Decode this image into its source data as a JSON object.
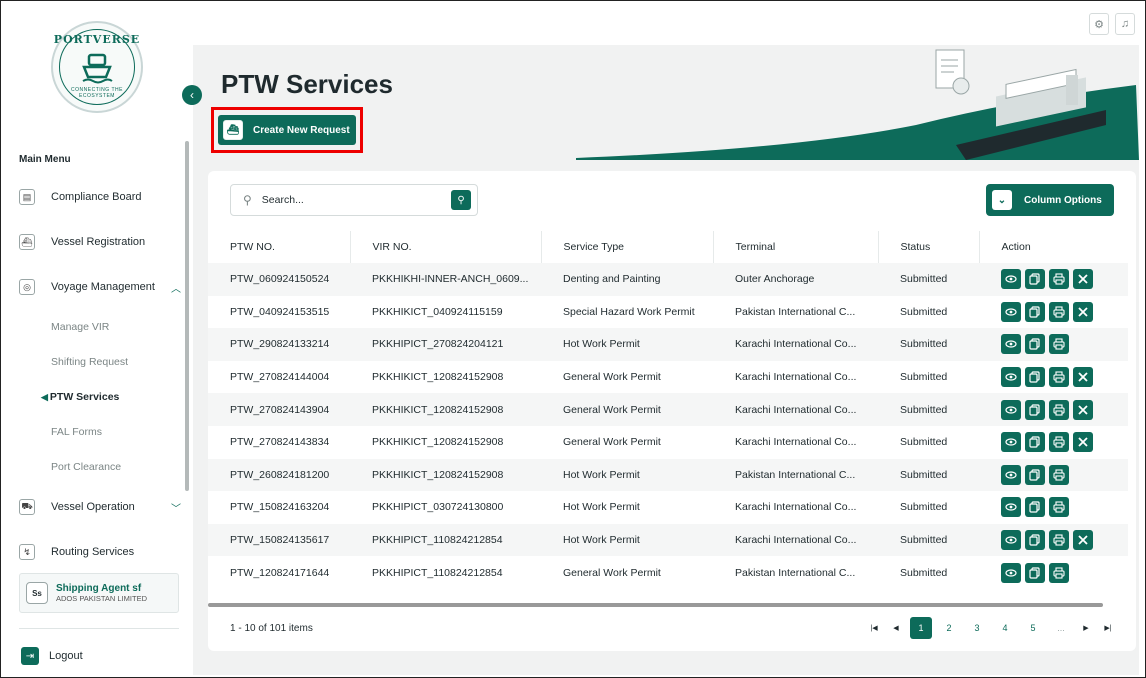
{
  "brand": {
    "name": "PORTVERSE",
    "tagline": "CONNECTING THE ECOSYSTEM"
  },
  "sidebar": {
    "menu_title": "Main Menu",
    "items": [
      {
        "label": "Compliance Board",
        "icon": "clipboard-icon"
      },
      {
        "label": "Vessel Registration",
        "icon": "ship-icon"
      },
      {
        "label": "Voyage Management",
        "icon": "shield-icon",
        "expanded": true
      },
      {
        "label": "Vessel Operation",
        "icon": "crane-icon",
        "expanded": false
      },
      {
        "label": "Routing Services",
        "icon": "route-icon"
      }
    ],
    "sub_items": [
      {
        "label": "Manage VIR"
      },
      {
        "label": "Shifting Request"
      },
      {
        "label": "PTW Services",
        "active": true
      },
      {
        "label": "FAL Forms"
      },
      {
        "label": "Port Clearance"
      }
    ],
    "agent": {
      "initials": "Ss",
      "name": "Shipping Agent sf",
      "org": "ADOS PAKISTAN LIMITED"
    },
    "logout": "Logout"
  },
  "header": {
    "title": "PTW Services",
    "create_label": "Create New Request"
  },
  "toolbar": {
    "search_placeholder": "Search...",
    "column_options": "Column Options"
  },
  "table": {
    "columns": [
      "PTW NO.",
      "VIR NO.",
      "Service Type",
      "Terminal",
      "Status",
      "Action"
    ],
    "rows": [
      {
        "ptw": "PTW_060924150524",
        "vir": "PKKHIKHI-INNER-ANCH_0609...",
        "service": "Denting and Painting",
        "terminal": "Outer Anchorage",
        "status": "Submitted",
        "cancel": true
      },
      {
        "ptw": "PTW_040924153515",
        "vir": "PKKHIKICT_040924115159",
        "service": "Special Hazard Work Permit",
        "terminal": "Pakistan International C...",
        "status": "Submitted",
        "cancel": true
      },
      {
        "ptw": "PTW_290824133214",
        "vir": "PKKHIPICT_270824204121",
        "service": "Hot Work Permit",
        "terminal": "Karachi International Co...",
        "status": "Submitted",
        "cancel": false
      },
      {
        "ptw": "PTW_270824144004",
        "vir": "PKKHIKICT_120824152908",
        "service": "General Work Permit",
        "terminal": "Karachi International Co...",
        "status": "Submitted",
        "cancel": true
      },
      {
        "ptw": "PTW_270824143904",
        "vir": "PKKHIKICT_120824152908",
        "service": "General Work Permit",
        "terminal": "Karachi International Co...",
        "status": "Submitted",
        "cancel": true
      },
      {
        "ptw": "PTW_270824143834",
        "vir": "PKKHIKICT_120824152908",
        "service": "General Work Permit",
        "terminal": "Karachi International Co...",
        "status": "Submitted",
        "cancel": true
      },
      {
        "ptw": "PTW_260824181200",
        "vir": "PKKHIKICT_120824152908",
        "service": "Hot Work Permit",
        "terminal": "Pakistan International C...",
        "status": "Submitted",
        "cancel": false
      },
      {
        "ptw": "PTW_150824163204",
        "vir": "PKKHIPICT_030724130800",
        "service": "Hot Work Permit",
        "terminal": "Karachi International Co...",
        "status": "Submitted",
        "cancel": false
      },
      {
        "ptw": "PTW_150824135617",
        "vir": "PKKHIPICT_110824212854",
        "service": "Hot Work Permit",
        "terminal": "Karachi International Co...",
        "status": "Submitted",
        "cancel": true
      },
      {
        "ptw": "PTW_120824171644",
        "vir": "PKKHIPICT_110824212854",
        "service": "General Work Permit",
        "terminal": "Pakistan International C...",
        "status": "Submitted",
        "cancel": false
      }
    ]
  },
  "pagination": {
    "summary": "1 - 10 of 101 items",
    "pages": [
      "1",
      "2",
      "3",
      "4",
      "5",
      "..."
    ],
    "current": "1"
  },
  "colors": {
    "accent": "#0d6b5a",
    "highlight": "#e00000"
  }
}
